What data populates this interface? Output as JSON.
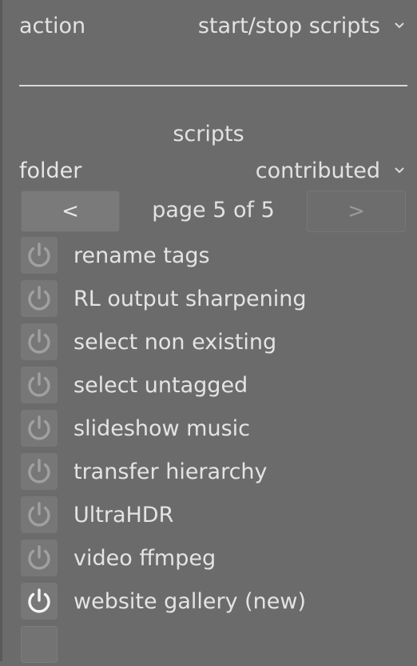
{
  "action": {
    "label": "action",
    "value": "start/stop scripts",
    "chevron_icon": "chevron-down-icon"
  },
  "scripts_section": {
    "title": "scripts",
    "folder_label": "folder",
    "folder_value": "contributed"
  },
  "pager": {
    "prev_label": "<",
    "page_text": "page 5 of 5",
    "next_label": ">"
  },
  "scripts": [
    {
      "label": "rename tags",
      "active": false
    },
    {
      "label": "RL output sharpening",
      "active": false
    },
    {
      "label": "select non existing",
      "active": false
    },
    {
      "label": "select untagged",
      "active": false
    },
    {
      "label": "slideshow music",
      "active": false
    },
    {
      "label": "transfer hierarchy",
      "active": false
    },
    {
      "label": "UltraHDR",
      "active": false
    },
    {
      "label": "video ffmpeg",
      "active": false
    },
    {
      "label": "website gallery (new)",
      "active": true
    }
  ],
  "colors": {
    "background": "#6b6b6b",
    "icon_inactive": "#a0a0a0",
    "icon_active": "#f4f4f4"
  }
}
